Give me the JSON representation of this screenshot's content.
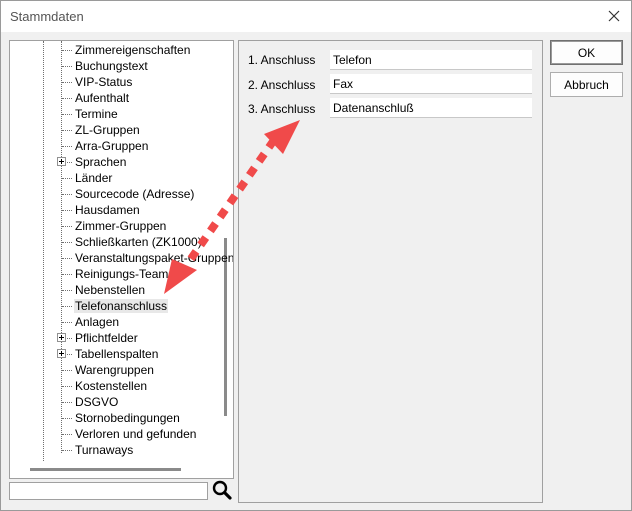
{
  "window": {
    "title": "Stammdaten"
  },
  "tree": {
    "items": [
      {
        "label": "Zimmereigenschaften",
        "expandable": false
      },
      {
        "label": "Buchungstext",
        "expandable": false
      },
      {
        "label": "VIP-Status",
        "expandable": false
      },
      {
        "label": "Aufenthalt",
        "expandable": false
      },
      {
        "label": "Termine",
        "expandable": false
      },
      {
        "label": "ZL-Gruppen",
        "expandable": false
      },
      {
        "label": "Arra-Gruppen",
        "expandable": false
      },
      {
        "label": "Sprachen",
        "expandable": true
      },
      {
        "label": "Länder",
        "expandable": false
      },
      {
        "label": "Sourcecode (Adresse)",
        "expandable": false
      },
      {
        "label": "Hausdamen",
        "expandable": false
      },
      {
        "label": "Zimmer-Gruppen",
        "expandable": false
      },
      {
        "label": "Schließkarten (ZK1000)",
        "expandable": false
      },
      {
        "label": "Veranstaltungspaket-Gruppen",
        "expandable": false
      },
      {
        "label": "Reinigungs-Teams",
        "expandable": false
      },
      {
        "label": "Nebenstellen",
        "expandable": false
      },
      {
        "label": "Telefonanschluss",
        "expandable": false,
        "selected": true
      },
      {
        "label": "Anlagen",
        "expandable": false
      },
      {
        "label": "Pflichtfelder",
        "expandable": true
      },
      {
        "label": "Tabellenspalten",
        "expandable": true
      },
      {
        "label": "Warengruppen",
        "expandable": false
      },
      {
        "label": "Kostenstellen",
        "expandable": false
      },
      {
        "label": "DSGVO",
        "expandable": false
      },
      {
        "label": "Stornobedingungen",
        "expandable": false
      },
      {
        "label": "Verloren und gefunden",
        "expandable": false
      },
      {
        "label": "Turnaways",
        "expandable": false
      }
    ]
  },
  "search": {
    "value": "",
    "icon": "magnifier-icon"
  },
  "form": {
    "rows": [
      {
        "label": "1. Anschluss",
        "value": "Telefon"
      },
      {
        "label": "2. Anschluss",
        "value": "Fax"
      },
      {
        "label": "3. Anschluss",
        "value": "Datenanschluß"
      }
    ]
  },
  "buttons": {
    "ok": "OK",
    "cancel": "Abbruch"
  },
  "colors": {
    "arrow": "#f04a4a"
  }
}
